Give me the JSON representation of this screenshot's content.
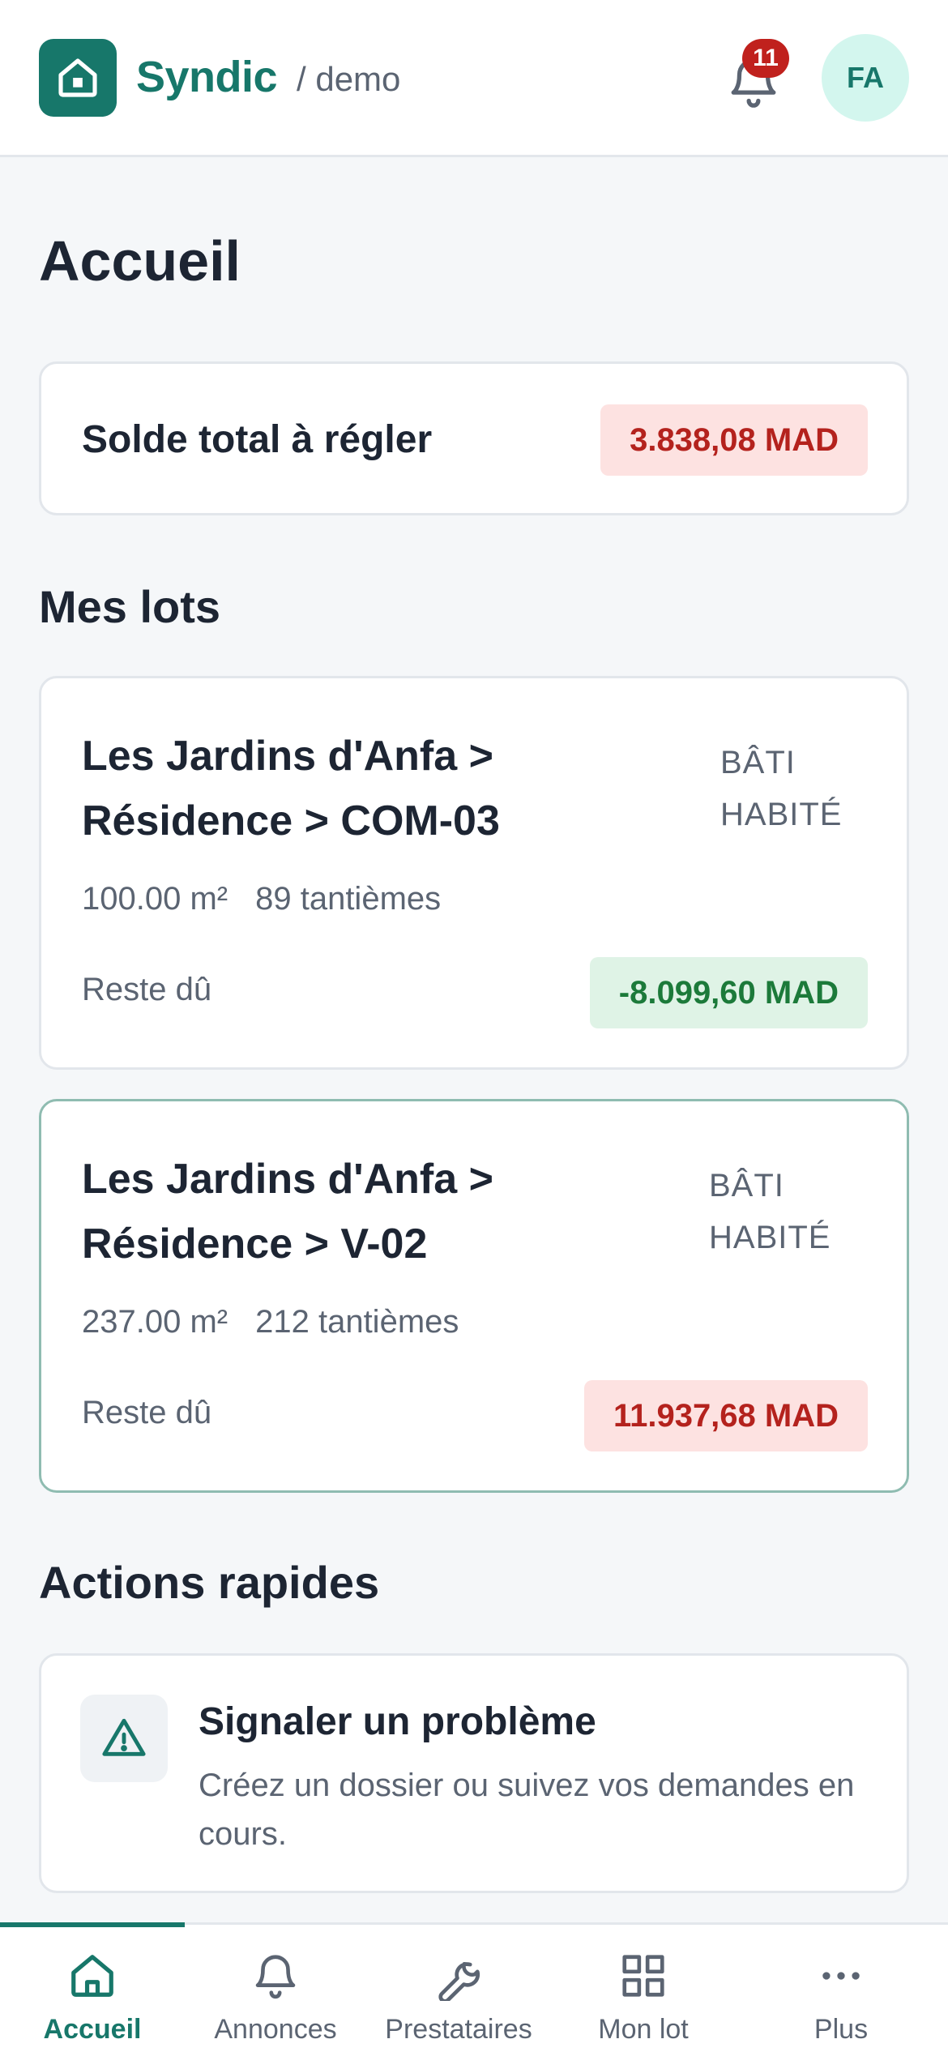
{
  "header": {
    "brand": "Syndic",
    "tenant": "/ demo",
    "notifications_count": "11",
    "avatar_initials": "FA"
  },
  "page_title": "Accueil",
  "balance": {
    "label": "Solde total à régler",
    "amount": "3.838,08 MAD",
    "status_color": "#b4221d"
  },
  "lots_section": {
    "title": "Mes lots",
    "lots": [
      {
        "title": "Les Jardins d'Anfa > Résidence > COM-03",
        "status_line1": "BÂTI",
        "status_line2": "HABITÉ",
        "surface": "100.00 m²",
        "tantiemes": "89 tantièmes",
        "due_label": "Reste dû",
        "due_amount": "-8.099,60 MAD",
        "due_color": "#1c7a3a"
      },
      {
        "title": "Les Jardins d'Anfa > Résidence > V-02",
        "status_line1": "BÂTI",
        "status_line2": "HABITÉ",
        "surface": "237.00 m²",
        "tantiemes": "212 tantièmes",
        "due_label": "Reste dû",
        "due_amount": "11.937,68 MAD",
        "due_color": "#b4221d"
      }
    ]
  },
  "quick_actions": {
    "title": "Actions rapides",
    "items": [
      {
        "icon": "warning-triangle-icon",
        "title": "Signaler un problème",
        "description": "Créez un dossier ou suivez vos demandes en cours."
      }
    ]
  },
  "bottom_nav": {
    "active": "Accueil",
    "accent_color": "#17776a",
    "items": [
      {
        "label": "Accueil",
        "icon": "home-icon"
      },
      {
        "label": "Annonces",
        "icon": "bell-icon"
      },
      {
        "label": "Prestataires",
        "icon": "wrench-icon"
      },
      {
        "label": "Mon lot",
        "icon": "grid-icon"
      },
      {
        "label": "Plus",
        "icon": "more-icon"
      }
    ]
  }
}
